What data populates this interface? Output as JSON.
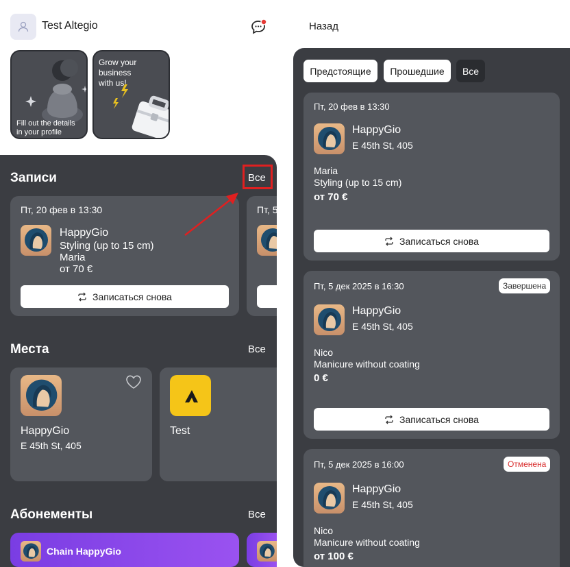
{
  "header": {
    "user_name": "Test Altegio"
  },
  "stories": [
    {
      "text_line1": "Fill out the details",
      "text_line2": "in your profile"
    },
    {
      "text_line1": "Grow your",
      "text_line2": "business",
      "text_line3": "with us!"
    }
  ],
  "appointments": {
    "title": "Записи",
    "all_label": "Все",
    "card": {
      "date": "Пт, 20 фев в 13:30",
      "business": "HappyGio",
      "service": "Styling (up to 15 cm)",
      "master": "Maria",
      "price": "от 70 €",
      "rebook_label": "Записаться снова"
    },
    "next_card_date": "Пт, 5"
  },
  "places": {
    "title": "Места",
    "all_label": "Все",
    "items": [
      {
        "name": "HappyGio",
        "address": "E 45th St, 405"
      },
      {
        "name": "Test"
      }
    ]
  },
  "subscriptions": {
    "title": "Абонементы",
    "all_label": "Все",
    "item_name": "Chain HappyGio"
  },
  "right": {
    "back_label": "Назад",
    "tabs": [
      "Предстоящие",
      "Прошедшие",
      "Все"
    ],
    "records": [
      {
        "date": "Пт, 20 фев в 13:30",
        "business": "HappyGio",
        "address": "E 45th St, 405",
        "master": "Maria",
        "service": "Styling (up to 15 cm)",
        "price": "от 70 €",
        "rebook_label": "Записаться снова"
      },
      {
        "date": "Пт, 5 дек 2025 в 16:30",
        "status": "Завершена",
        "business": "HappyGio",
        "address": "E 45th St, 405",
        "master": "Nico",
        "service": "Manicure without coating",
        "price": "0 €",
        "rebook_label": "Записаться снова"
      },
      {
        "date": "Пт, 5 дек 2025 в 16:00",
        "status": "Отменена",
        "business": "HappyGio",
        "address": "E 45th St, 405",
        "master": "Nico",
        "service": "Manicure without coating",
        "price": "от 100 €"
      }
    ]
  },
  "colors": {
    "annotation": "#e02020",
    "status_cancelled": "#d93030",
    "subscription": "#8a45ea",
    "test_logo": "#f5c518"
  }
}
